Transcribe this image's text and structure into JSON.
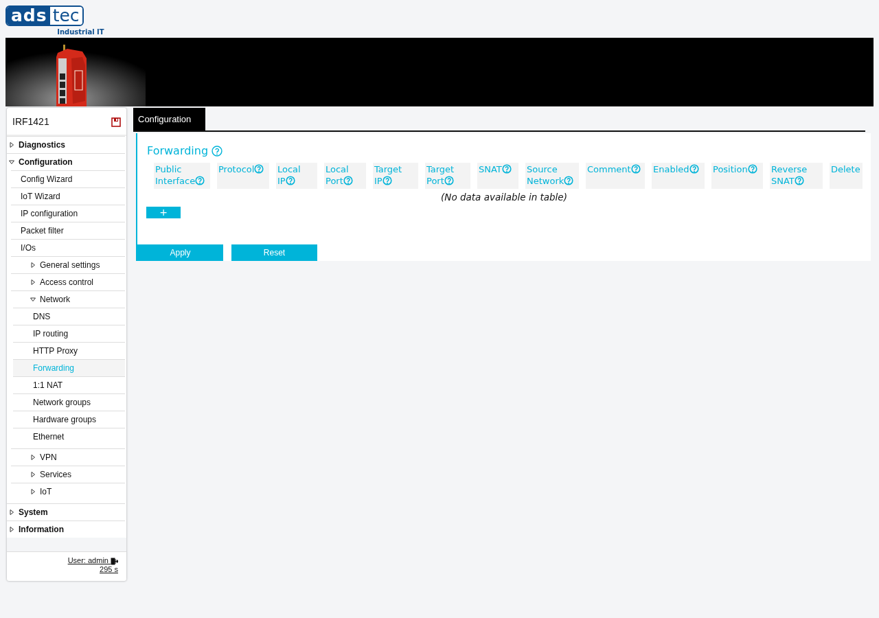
{
  "logo": {
    "part_1": "ads",
    "part_2": "tec",
    "tagline": "Industrial IT"
  },
  "sidebar": {
    "device": "IRF1421",
    "items": [
      {
        "label": "Diagnostics",
        "expanded": false,
        "selected": false
      },
      {
        "label": "Configuration",
        "expanded": true,
        "selected": false,
        "children": [
          {
            "label": "Config Wizard",
            "selected": false
          },
          {
            "label": "IoT Wizard",
            "selected": false
          },
          {
            "label": "IP configuration",
            "selected": false
          },
          {
            "label": "Packet filter",
            "selected": false
          },
          {
            "label": "I/Os",
            "selected": false,
            "children": [
              {
                "label": "General settings",
                "expanded": false,
                "selected": false
              },
              {
                "label": "Access control",
                "expanded": false,
                "selected": false
              },
              {
                "label": "Network",
                "expanded": true,
                "selected": false,
                "children": [
                  {
                    "label": "DNS",
                    "selected": false
                  },
                  {
                    "label": "IP routing",
                    "selected": false
                  },
                  {
                    "label": "HTTP Proxy",
                    "selected": false
                  },
                  {
                    "label": "Forwarding",
                    "selected": true
                  },
                  {
                    "label": "1:1 NAT",
                    "selected": false
                  },
                  {
                    "label": "Network groups",
                    "selected": false
                  },
                  {
                    "label": "Hardware groups",
                    "selected": false
                  },
                  {
                    "label": "Ethernet",
                    "selected": false
                  }
                ]
              },
              {
                "label": "VPN",
                "expanded": false,
                "selected": false
              },
              {
                "label": "Services",
                "expanded": false,
                "selected": false
              },
              {
                "label": "IoT",
                "expanded": false,
                "selected": false
              }
            ]
          }
        ]
      },
      {
        "label": "System",
        "expanded": false,
        "selected": false
      },
      {
        "label": "Information",
        "expanded": false,
        "selected": false
      }
    ],
    "user": "User: admin",
    "timer": "295 s"
  },
  "tabs": [
    {
      "label": "Configuration",
      "selected": true
    }
  ],
  "section": {
    "title": "Forwarding",
    "table": {
      "columns": [
        {
          "label": "Public Interface",
          "help": true
        },
        {
          "label": "Protocol",
          "help": true
        },
        {
          "label": "Local IP",
          "help": true
        },
        {
          "label": "Local Port",
          "help": true
        },
        {
          "label": "Target IP",
          "help": true
        },
        {
          "label": "Target Port",
          "help": true
        },
        {
          "label": "SNAT",
          "help": true
        },
        {
          "label": "Source Network",
          "help": true
        },
        {
          "label": "Comment",
          "help": true
        },
        {
          "label": "Enabled",
          "help": true
        },
        {
          "label": "Position",
          "help": true
        },
        {
          "label": "Reverse SNAT",
          "help": true
        },
        {
          "label": "Delete",
          "help": false
        }
      ],
      "empty_message": "(No data available in table)"
    },
    "add_button": "+"
  },
  "buttons": [
    "Apply",
    "Reset"
  ]
}
